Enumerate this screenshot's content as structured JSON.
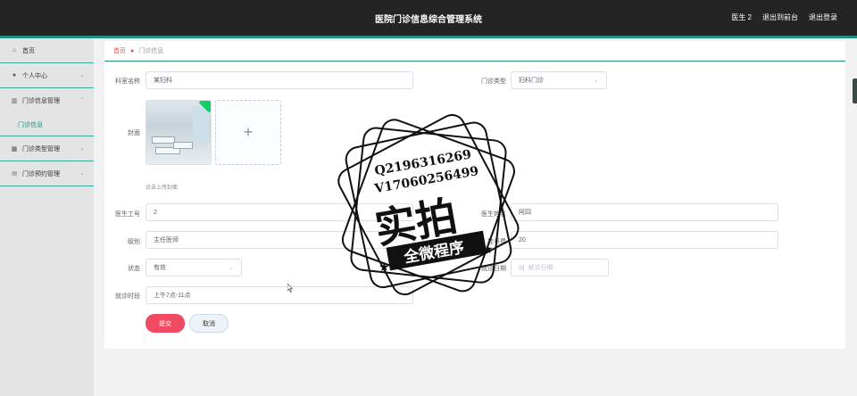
{
  "header": {
    "title": "医院门诊信息综合管理系统",
    "user": "医生 2",
    "to_admin": "退出到前台",
    "logout": "退出登录"
  },
  "sidebar": {
    "items": [
      {
        "label": "首页",
        "icon": "home-icon"
      },
      {
        "label": "个人中心",
        "icon": "user-icon"
      },
      {
        "label": "门诊信息管理",
        "icon": "chart-icon"
      },
      {
        "label": "门诊类型管理",
        "icon": "grid-icon"
      },
      {
        "label": "门诊预约管理",
        "icon": "mail-icon"
      }
    ],
    "sub_item": "门诊信息"
  },
  "breadcrumb": {
    "home": "首页",
    "current": "门诊信息"
  },
  "form": {
    "dept_label": "科室名称",
    "dept_value": "某妇科",
    "type_label": "门诊类型",
    "type_value": "妇科门诊",
    "cover_label": "封面",
    "upload_plus": "+",
    "upload_hint": "点击上传封面",
    "doc_no_label": "医生工号",
    "doc_no_value": "2",
    "doc_name_label": "医生姓名",
    "doc_name_value": "阿四",
    "level_label": "级别",
    "level_value": "主任医师",
    "fee_label": "挂号费",
    "fee_value": "20",
    "status_label": "状态",
    "status_value": "有效",
    "date_label": "就诊日期",
    "date_placeholder": "就诊日期",
    "period_label": "就诊时段",
    "period_value": "上午7点-11点",
    "submit": "提交",
    "cancel": "取消"
  },
  "watermark": {
    "line1": "Q2196316269",
    "line2": "V17060256499",
    "main": "实拍",
    "sub": "全微程序"
  }
}
